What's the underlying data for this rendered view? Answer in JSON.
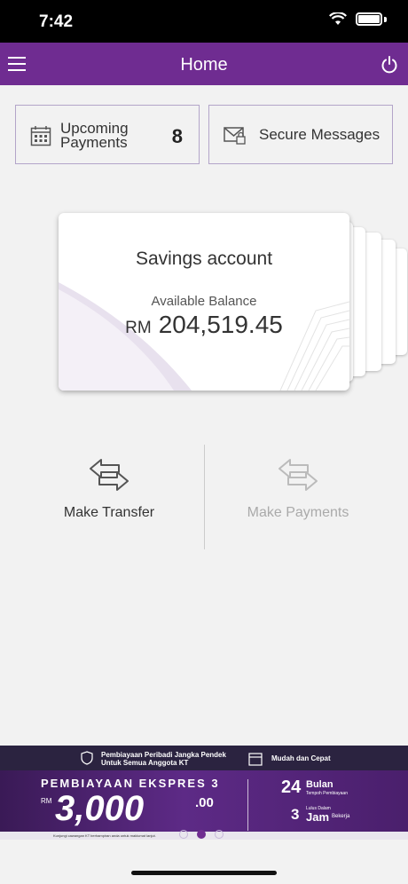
{
  "status_bar": {
    "time": "7:42"
  },
  "nav": {
    "title": "Home"
  },
  "tiles": {
    "upcoming_line1": "Upcoming",
    "upcoming_line2": "Payments",
    "upcoming_count": "8",
    "secure_label": "Secure Messages"
  },
  "card": {
    "title": "Savings account",
    "available_label": "Available Balance",
    "currency": "RM",
    "balance": "204,519.45"
  },
  "actions": {
    "transfer_label": "Make Transfer",
    "payments_label": "Make Payments"
  },
  "banner": {
    "line1": "Pembiayaan Peribadi Jangka Pendek",
    "line2": "Untuk Semua Anggota KT",
    "fast": "Mudah dan Cepat",
    "headline": "PEMBIAYAAN EKSPRES 3",
    "rm": "RM",
    "amount": "3,000",
    "cents": ".00",
    "months_value": "24",
    "months_label": "Bulan",
    "tenure_label": "Tempoh Pembiayaan",
    "hours_value": "3",
    "approval_label": "Lulus Dalam",
    "hours_label": "Jam",
    "working_label": "Bekerja",
    "footer": "Kunjungi cawangan KT berhampiran anda untuk maklumat lanjut."
  },
  "carousel": {
    "active_index": 1,
    "count": 3
  },
  "colors": {
    "brand": "#6f2c91",
    "tile_border": "#b3a5c9",
    "disabled_text": "#aaaaaa"
  }
}
